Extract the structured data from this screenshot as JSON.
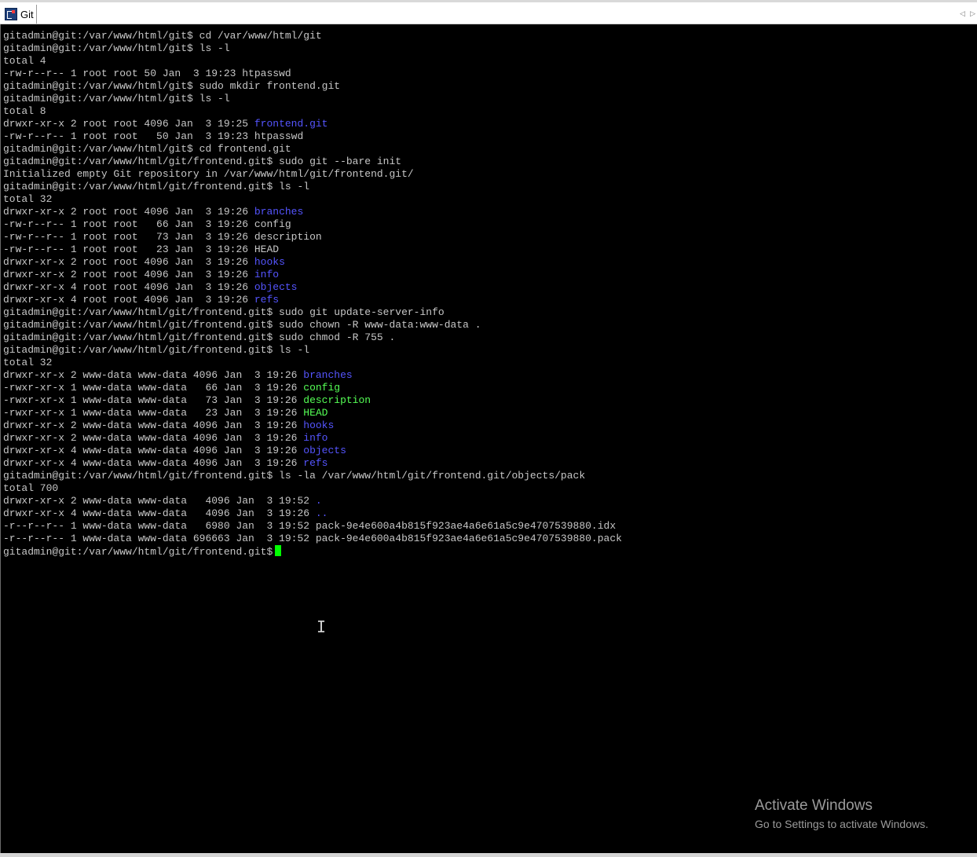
{
  "window": {
    "tab_title": "Git",
    "tab_icon": "putty-terminal-icon",
    "scroll_left": "◁",
    "scroll_right": "▷"
  },
  "colors": {
    "directory": "#5555ff",
    "executable": "#55ff55",
    "text": "#c7c7c7",
    "cursor": "#00ff00"
  },
  "terminal": {
    "lines": [
      [
        {
          "t": "gitadmin@git:/var/www/html/git$ cd /var/www/html/git"
        }
      ],
      [
        {
          "t": "gitadmin@git:/var/www/html/git$ ls -l"
        }
      ],
      [
        {
          "t": "total 4"
        }
      ],
      [
        {
          "t": "-rw-r--r-- 1 root root 50 Jan  3 19:23 htpasswd"
        }
      ],
      [
        {
          "t": "gitadmin@git:/var/www/html/git$ sudo mkdir frontend.git"
        }
      ],
      [
        {
          "t": "gitadmin@git:/var/www/html/git$ ls -l"
        }
      ],
      [
        {
          "t": "total 8"
        }
      ],
      [
        {
          "t": "drwxr-xr-x 2 root root 4096 Jan  3 19:25 "
        },
        {
          "t": "frontend.git",
          "c": "blue"
        }
      ],
      [
        {
          "t": "-rw-r--r-- 1 root root   50 Jan  3 19:23 htpasswd"
        }
      ],
      [
        {
          "t": "gitadmin@git:/var/www/html/git$ cd frontend.git"
        }
      ],
      [
        {
          "t": "gitadmin@git:/var/www/html/git/frontend.git$ sudo git --bare init"
        }
      ],
      [
        {
          "t": "Initialized empty Git repository in /var/www/html/git/frontend.git/"
        }
      ],
      [
        {
          "t": "gitadmin@git:/var/www/html/git/frontend.git$ ls -l"
        }
      ],
      [
        {
          "t": "total 32"
        }
      ],
      [
        {
          "t": "drwxr-xr-x 2 root root 4096 Jan  3 19:26 "
        },
        {
          "t": "branches",
          "c": "blue"
        }
      ],
      [
        {
          "t": "-rw-r--r-- 1 root root   66 Jan  3 19:26 config"
        }
      ],
      [
        {
          "t": "-rw-r--r-- 1 root root   73 Jan  3 19:26 description"
        }
      ],
      [
        {
          "t": "-rw-r--r-- 1 root root   23 Jan  3 19:26 HEAD"
        }
      ],
      [
        {
          "t": "drwxr-xr-x 2 root root 4096 Jan  3 19:26 "
        },
        {
          "t": "hooks",
          "c": "blue"
        }
      ],
      [
        {
          "t": "drwxr-xr-x 2 root root 4096 Jan  3 19:26 "
        },
        {
          "t": "info",
          "c": "blue"
        }
      ],
      [
        {
          "t": "drwxr-xr-x 4 root root 4096 Jan  3 19:26 "
        },
        {
          "t": "objects",
          "c": "blue"
        }
      ],
      [
        {
          "t": "drwxr-xr-x 4 root root 4096 Jan  3 19:26 "
        },
        {
          "t": "refs",
          "c": "blue"
        }
      ],
      [
        {
          "t": "gitadmin@git:/var/www/html/git/frontend.git$ sudo git update-server-info"
        }
      ],
      [
        {
          "t": "gitadmin@git:/var/www/html/git/frontend.git$ sudo chown -R www-data:www-data ."
        }
      ],
      [
        {
          "t": "gitadmin@git:/var/www/html/git/frontend.git$ sudo chmod -R 755 ."
        }
      ],
      [
        {
          "t": "gitadmin@git:/var/www/html/git/frontend.git$ ls -l"
        }
      ],
      [
        {
          "t": "total 32"
        }
      ],
      [
        {
          "t": "drwxr-xr-x 2 www-data www-data 4096 Jan  3 19:26 "
        },
        {
          "t": "branches",
          "c": "blue"
        }
      ],
      [
        {
          "t": "-rwxr-xr-x 1 www-data www-data   66 Jan  3 19:26 "
        },
        {
          "t": "config",
          "c": "green"
        }
      ],
      [
        {
          "t": "-rwxr-xr-x 1 www-data www-data   73 Jan  3 19:26 "
        },
        {
          "t": "description",
          "c": "green"
        }
      ],
      [
        {
          "t": "-rwxr-xr-x 1 www-data www-data   23 Jan  3 19:26 "
        },
        {
          "t": "HEAD",
          "c": "green"
        }
      ],
      [
        {
          "t": "drwxr-xr-x 2 www-data www-data 4096 Jan  3 19:26 "
        },
        {
          "t": "hooks",
          "c": "blue"
        }
      ],
      [
        {
          "t": "drwxr-xr-x 2 www-data www-data 4096 Jan  3 19:26 "
        },
        {
          "t": "info",
          "c": "blue"
        }
      ],
      [
        {
          "t": "drwxr-xr-x 4 www-data www-data 4096 Jan  3 19:26 "
        },
        {
          "t": "objects",
          "c": "blue"
        }
      ],
      [
        {
          "t": "drwxr-xr-x 4 www-data www-data 4096 Jan  3 19:26 "
        },
        {
          "t": "refs",
          "c": "blue"
        }
      ],
      [
        {
          "t": "gitadmin@git:/var/www/html/git/frontend.git$ ls -la /var/www/html/git/frontend.git/objects/pack"
        }
      ],
      [
        {
          "t": "total 700"
        }
      ],
      [
        {
          "t": "drwxr-xr-x 2 www-data www-data   4096 Jan  3 19:52 "
        },
        {
          "t": ".",
          "c": "blue"
        }
      ],
      [
        {
          "t": "drwxr-xr-x 4 www-data www-data   4096 Jan  3 19:26 "
        },
        {
          "t": "..",
          "c": "blue"
        }
      ],
      [
        {
          "t": "-r--r--r-- 1 www-data www-data   6980 Jan  3 19:52 pack-9e4e600a4b815f923ae4a6e61a5c9e4707539880.idx"
        }
      ],
      [
        {
          "t": "-r--r--r-- 1 www-data www-data 696663 Jan  3 19:52 pack-9e4e600a4b815f923ae4a6e61a5c9e4707539880.pack"
        }
      ]
    ],
    "prompt": "gitadmin@git:/var/www/html/git/frontend.git$"
  },
  "watermark": {
    "title": "Activate Windows",
    "subtitle": "Go to Settings to activate Windows."
  },
  "mouse_cursor": "I"
}
